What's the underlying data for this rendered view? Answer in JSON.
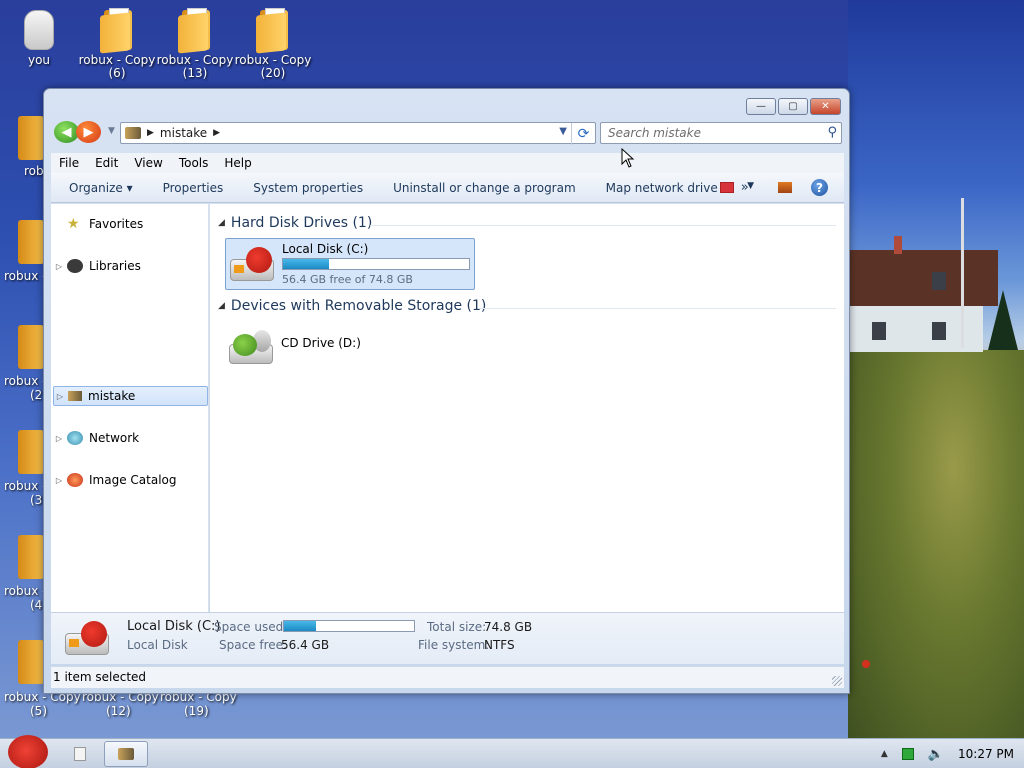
{
  "desktop": {
    "top_icons": [
      {
        "label_line1": "you",
        "label_line2": ""
      },
      {
        "label_line1": "robux - Copy",
        "label_line2": "(6)"
      },
      {
        "label_line1": "robux - Copy",
        "label_line2": "(13)"
      },
      {
        "label_line1": "robux - Copy",
        "label_line2": "(20)"
      }
    ],
    "left_partial_labels": [
      "rob",
      "robux -",
      "robux -",
      "(2",
      "robux -",
      "(3",
      "robux -",
      "(4"
    ],
    "bottom_labels": [
      "robux - Copy",
      "robux - Copy",
      "robux - Copy"
    ],
    "bottom_sub": [
      "(5)",
      "(12)",
      "(19)"
    ]
  },
  "window": {
    "caption_buttons": {
      "minimize": "—",
      "maximize": "▢",
      "close": "✕"
    },
    "address": {
      "segment": "mistake"
    },
    "search": {
      "placeholder": "Search mistake"
    },
    "menu": [
      "File",
      "Edit",
      "View",
      "Tools",
      "Help"
    ],
    "commands": {
      "organize": "Organize ▾",
      "properties": "Properties",
      "system_properties": "System properties",
      "uninstall": "Uninstall or change a program",
      "map_drive": "Map network drive",
      "more": "»"
    },
    "nav": {
      "favorites": "Favorites",
      "libraries": "Libraries",
      "mistake": "mistake",
      "network": "Network",
      "image_catalog": "Image Catalog"
    },
    "groups": {
      "hdd": "Hard Disk Drives (1)",
      "removable": "Devices with Removable Storage (1)"
    },
    "local_disk": {
      "name": "Local Disk (C:)",
      "free_text": "56.4 GB free of 74.8 GB",
      "used_fraction": 0.246
    },
    "cd_drive": {
      "name": "CD Drive (D:)"
    },
    "details": {
      "title": "Local Disk (C:)",
      "subtitle": "Local Disk",
      "space_used_label": "Space used:",
      "space_free_label": "Space free:",
      "space_free_value": "56.4 GB",
      "total_size_label": "Total size:",
      "total_size_value": "74.8 GB",
      "file_system_label": "File system:",
      "file_system_value": "NTFS"
    },
    "status": "1 item selected"
  },
  "taskbar": {
    "clock": "10:27 PM"
  },
  "colors": {
    "accent": "#1e395b",
    "bar_fill": "#1b8ac4",
    "selection": "#d6e6fa"
  }
}
